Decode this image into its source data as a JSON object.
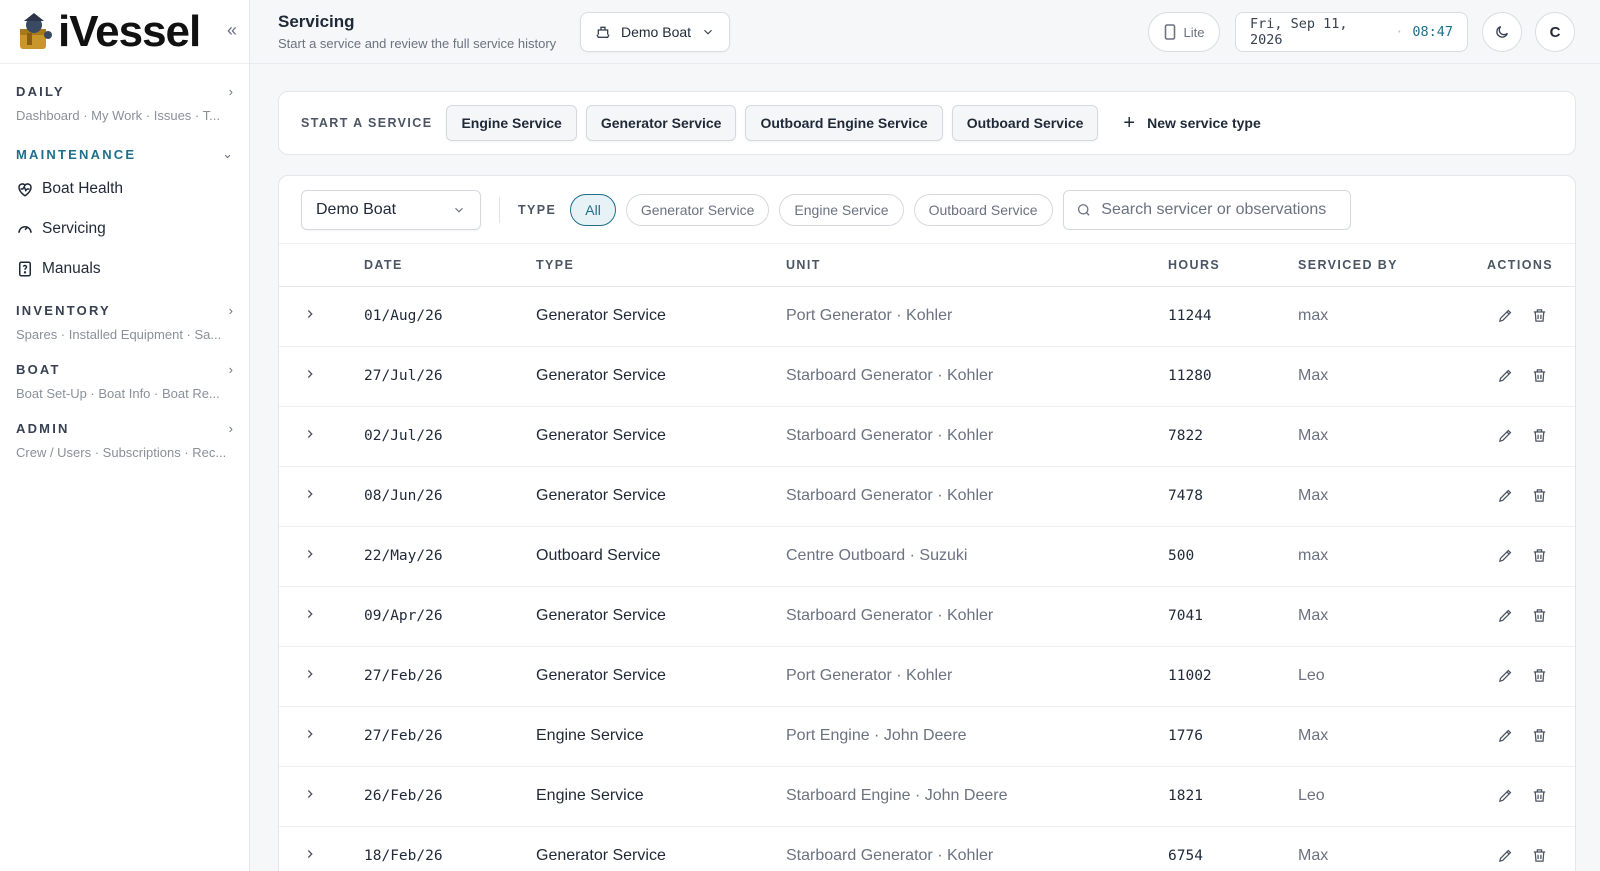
{
  "brand": {
    "name": "iVessel"
  },
  "sidebar": {
    "sections": [
      {
        "label": "DAILY",
        "sub": "Dashboard · My Work · Issues · T..."
      },
      {
        "label": "MAINTENANCE"
      },
      {
        "label": "INVENTORY",
        "sub": "Spares · Installed Equipment · Sa..."
      },
      {
        "label": "BOAT",
        "sub": "Boat Set-Up · Boat Info · Boat Re..."
      },
      {
        "label": "ADMIN",
        "sub": "Crew / Users · Subscriptions · Rec..."
      }
    ],
    "maintenance_items": [
      {
        "label": "Boat Health",
        "icon": "heart-pulse-icon"
      },
      {
        "label": "Servicing",
        "icon": "gauge-icon"
      },
      {
        "label": "Manuals",
        "icon": "manual-icon"
      }
    ]
  },
  "header": {
    "title": "Servicing",
    "subtitle": "Start a service and review the full service history",
    "boat": "Demo Boat",
    "lite_label": "Lite",
    "date": "Fri, Sep 11, 2026",
    "time": "08:47",
    "avatar_initial": "C"
  },
  "start_service": {
    "label": "START A SERVICE",
    "buttons": [
      "Engine Service",
      "Generator Service",
      "Outboard Engine Service",
      "Outboard Service"
    ],
    "new_type_label": "New service type"
  },
  "filters": {
    "boat": "Demo Boat",
    "type_label": "TYPE",
    "chips": [
      "All",
      "Generator Service",
      "Engine Service",
      "Outboard Service"
    ],
    "active_chip": "All",
    "search_placeholder": "Search servicer or observations"
  },
  "table": {
    "columns": [
      "DATE",
      "TYPE",
      "UNIT",
      "HOURS",
      "SERVICED BY",
      "ACTIONS"
    ],
    "rows": [
      {
        "date": "01/Aug/26",
        "type": "Generator Service",
        "unit": "Port Generator · Kohler",
        "hours": "11244",
        "by": "max"
      },
      {
        "date": "27/Jul/26",
        "type": "Generator Service",
        "unit": "Starboard Generator · Kohler",
        "hours": "11280",
        "by": "Max"
      },
      {
        "date": "02/Jul/26",
        "type": "Generator Service",
        "unit": "Starboard Generator · Kohler",
        "hours": "7822",
        "by": "Max"
      },
      {
        "date": "08/Jun/26",
        "type": "Generator Service",
        "unit": "Starboard Generator · Kohler",
        "hours": "7478",
        "by": "Max"
      },
      {
        "date": "22/May/26",
        "type": "Outboard Service",
        "unit": "Centre Outboard · Suzuki",
        "hours": "500",
        "by": "max"
      },
      {
        "date": "09/Apr/26",
        "type": "Generator Service",
        "unit": "Starboard Generator · Kohler",
        "hours": "7041",
        "by": "Max"
      },
      {
        "date": "27/Feb/26",
        "type": "Generator Service",
        "unit": "Port Generator · Kohler",
        "hours": "11002",
        "by": "Leo"
      },
      {
        "date": "27/Feb/26",
        "type": "Engine Service",
        "unit": "Port Engine · John Deere",
        "hours": "1776",
        "by": "Max"
      },
      {
        "date": "26/Feb/26",
        "type": "Engine Service",
        "unit": "Starboard Engine · John Deere",
        "hours": "1821",
        "by": "Leo"
      },
      {
        "date": "18/Feb/26",
        "type": "Generator Service",
        "unit": "Starboard Generator · Kohler",
        "hours": "6754",
        "by": "Max"
      }
    ]
  },
  "colors": {
    "accent": "#1f6f8b",
    "muted": "#6b7280"
  }
}
